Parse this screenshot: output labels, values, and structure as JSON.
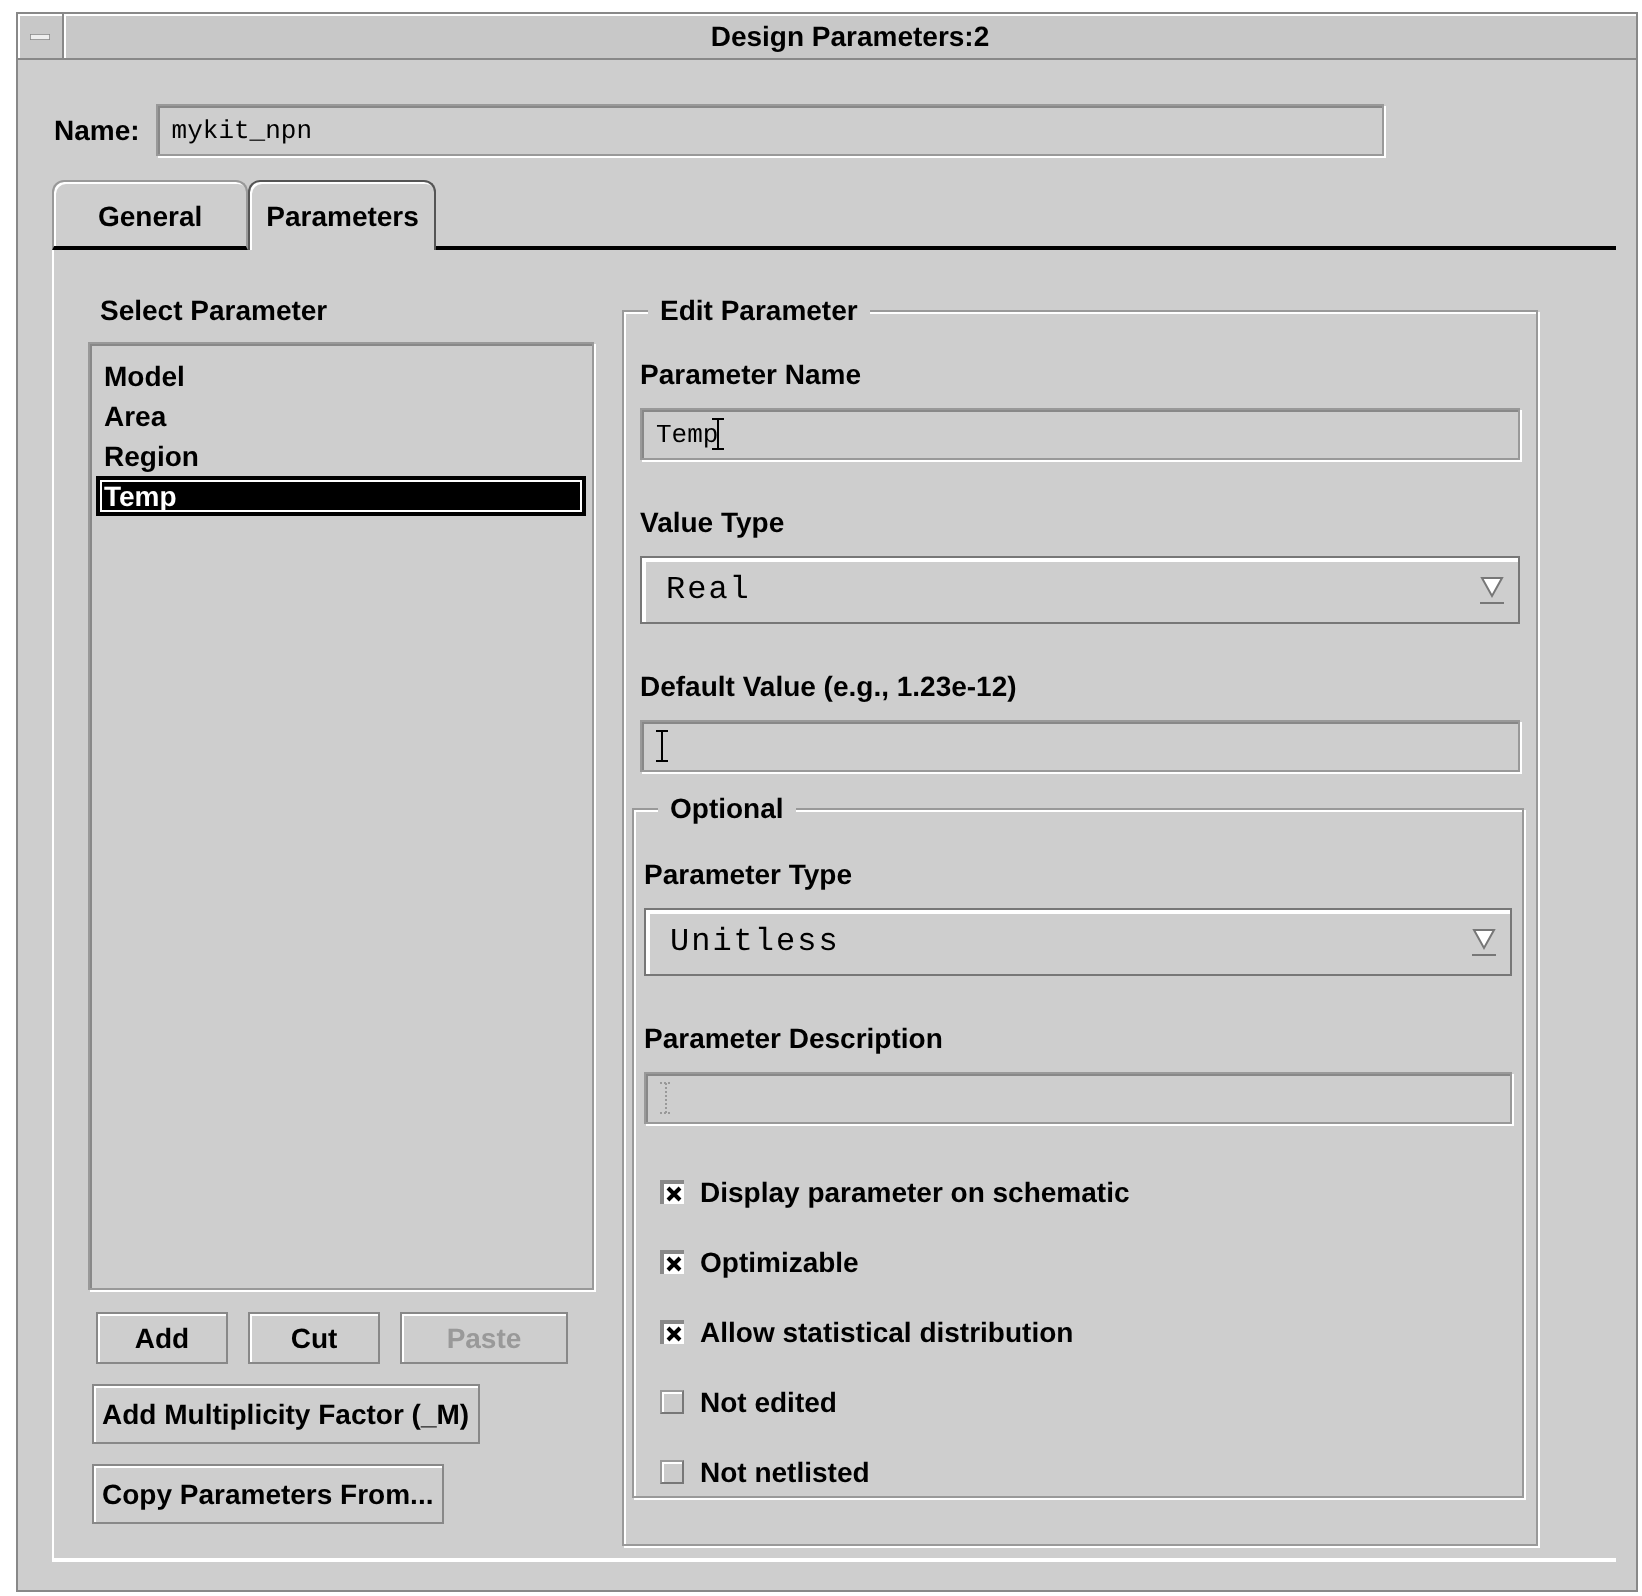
{
  "window": {
    "title": "Design Parameters:2"
  },
  "name": {
    "label": "Name:",
    "value": "mykit_npn"
  },
  "tabs": [
    {
      "label": "General",
      "selected": false
    },
    {
      "label": "Parameters",
      "selected": true
    }
  ],
  "select_parameter": {
    "title": "Select Parameter",
    "items": [
      {
        "label": "Model",
        "selected": false
      },
      {
        "label": "Area",
        "selected": false
      },
      {
        "label": "Region",
        "selected": false
      },
      {
        "label": "Temp",
        "selected": true
      }
    ]
  },
  "list_buttons": [
    {
      "label": "Add",
      "disabled": false
    },
    {
      "label": "Cut",
      "disabled": false
    },
    {
      "label": "Paste",
      "disabled": true
    }
  ],
  "wide_buttons": [
    {
      "label": "Add Multiplicity Factor (_M)"
    },
    {
      "label": "Copy Parameters From..."
    }
  ],
  "edit_parameter": {
    "title": "Edit Parameter",
    "fields": [
      {
        "kind": "text",
        "label": "Parameter Name",
        "value": "Temp",
        "disabled": false
      },
      {
        "kind": "dropdown",
        "label": "Value Type",
        "value": "Real"
      },
      {
        "kind": "text",
        "label": "Default Value (e.g., 1.23e-12)",
        "disabled": false
      }
    ],
    "optional": {
      "title": "Optional",
      "fields": [
        {
          "kind": "dropdown",
          "label": "Parameter Type",
          "value": "Unitless"
        },
        {
          "kind": "text",
          "label": "Parameter Description",
          "disabled": true
        }
      ],
      "checkboxes": [
        {
          "label": "Display parameter on schematic",
          "checked": true
        },
        {
          "label": "Optimizable",
          "checked": true
        },
        {
          "label": "Allow statistical distribution",
          "checked": true
        },
        {
          "label": "Not edited",
          "checked": false
        },
        {
          "label": "Not netlisted",
          "checked": false
        }
      ]
    }
  }
}
